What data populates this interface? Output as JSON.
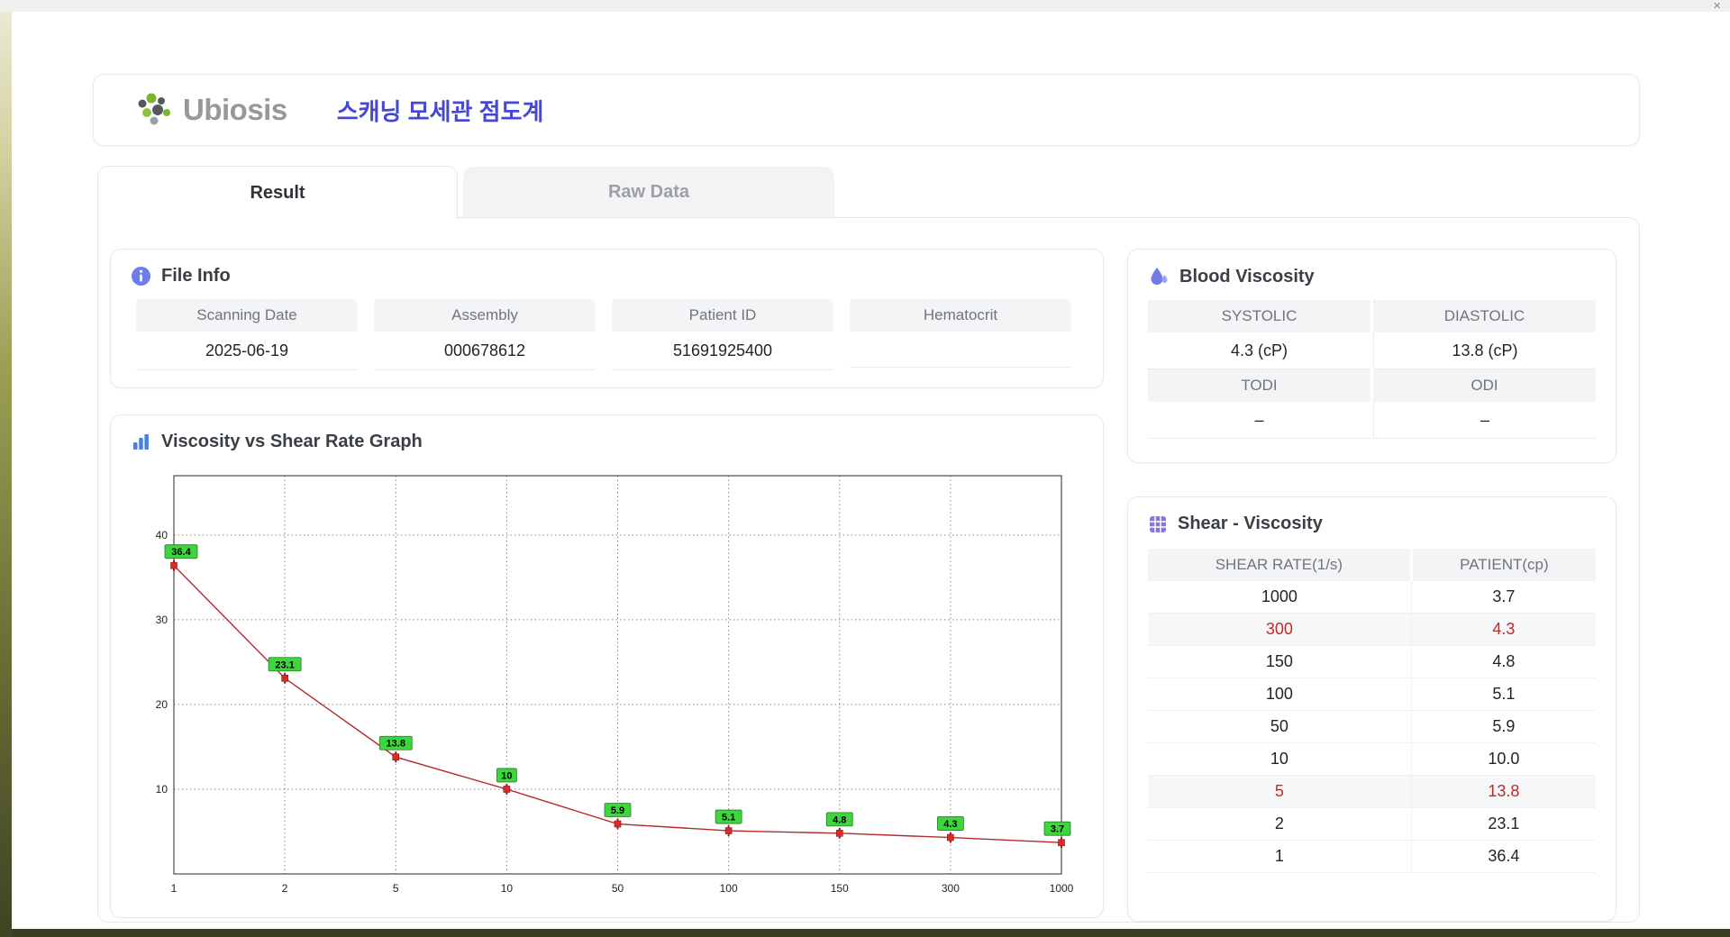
{
  "window": {
    "close_label": "×"
  },
  "header": {
    "brand": "Ubiosis",
    "title": "스캐닝 모세관 점도계"
  },
  "tabs": [
    {
      "label": "Result",
      "active": true
    },
    {
      "label": "Raw Data",
      "active": false
    }
  ],
  "file_info": {
    "title": "File Info",
    "fields": [
      {
        "label": "Scanning Date",
        "value": "2025-06-19"
      },
      {
        "label": "Assembly",
        "value": "000678612"
      },
      {
        "label": "Patient ID",
        "value": "51691925400"
      },
      {
        "label": "Hematocrit",
        "value": ""
      }
    ]
  },
  "blood_viscosity": {
    "title": "Blood Viscosity",
    "systolic_label": "SYSTOLIC",
    "diastolic_label": "DIASTOLIC",
    "systolic_value": "4.3 (cP)",
    "diastolic_value": "13.8 (cP)",
    "todi_label": "TODI",
    "odi_label": "ODI",
    "todi_value": "–",
    "odi_value": "–"
  },
  "graph": {
    "title": "Viscosity vs Shear Rate Graph"
  },
  "chart_data": {
    "type": "line",
    "title": "Viscosity vs Shear Rate Graph",
    "x": [
      1,
      2,
      5,
      10,
      50,
      100,
      150,
      300,
      1000
    ],
    "values": [
      36.4,
      23.1,
      13.8,
      10,
      5.9,
      5.1,
      4.8,
      4.3,
      3.7
    ],
    "point_labels": [
      "36.4",
      "23.1",
      "13.8",
      "10",
      "5.9",
      "5.1",
      "4.8",
      "4.3",
      "3.7"
    ],
    "x_scale": "categorical-equal-spacing",
    "yticks": [
      10,
      20,
      30,
      40
    ],
    "ylim": [
      0,
      47
    ],
    "grid": "dotted",
    "line_color": "#b42a2a",
    "marker_color": "#d92b2b",
    "label_bg_color": "#3ed63e",
    "xlabel": "",
    "ylabel": ""
  },
  "shear_viscosity": {
    "title": "Shear - Viscosity",
    "columns": [
      "SHEAR RATE(1/s)",
      "PATIENT(cp)"
    ],
    "rows": [
      {
        "shear": "1000",
        "patient": "3.7",
        "highlight": false
      },
      {
        "shear": "300",
        "patient": "4.3",
        "highlight": true
      },
      {
        "shear": "150",
        "patient": "4.8",
        "highlight": false
      },
      {
        "shear": "100",
        "patient": "5.1",
        "highlight": false
      },
      {
        "shear": "50",
        "patient": "5.9",
        "highlight": false
      },
      {
        "shear": "10",
        "patient": "10.0",
        "highlight": false
      },
      {
        "shear": "5",
        "patient": "13.8",
        "highlight": true
      },
      {
        "shear": "2",
        "patient": "23.1",
        "highlight": false
      },
      {
        "shear": "1",
        "patient": "36.4",
        "highlight": false
      }
    ]
  }
}
